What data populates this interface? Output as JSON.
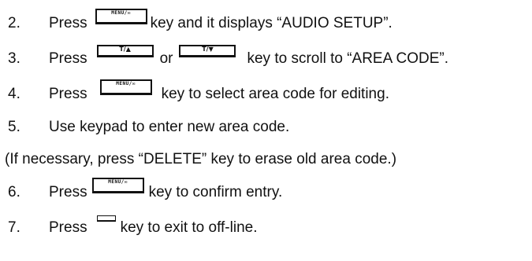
{
  "steps": [
    {
      "num": "2.",
      "press": "Press",
      "key": "MENU/✉",
      "rest": "key and it displays “AUDIO SETUP”."
    },
    {
      "num": "3.",
      "press": "Press",
      "key_a": "T/▲",
      "or": "or",
      "key_b": "T/▼",
      "rest": "key to scroll to “AREA CODE”."
    },
    {
      "num": "4.",
      "press": "Press",
      "key": "MENU/✉",
      "rest": "key to select area code for editing."
    },
    {
      "num": "5.",
      "text": "Use keypad to enter new area code."
    },
    {
      "num": "6.",
      "press": "Press",
      "key": "MENU/✉",
      "rest": "key to confirm entry."
    },
    {
      "num": "7.",
      "press": "Press",
      "rest": "key to exit to off-line."
    }
  ],
  "note": "(If necessary, press “DELETE” key to erase old area code.)"
}
